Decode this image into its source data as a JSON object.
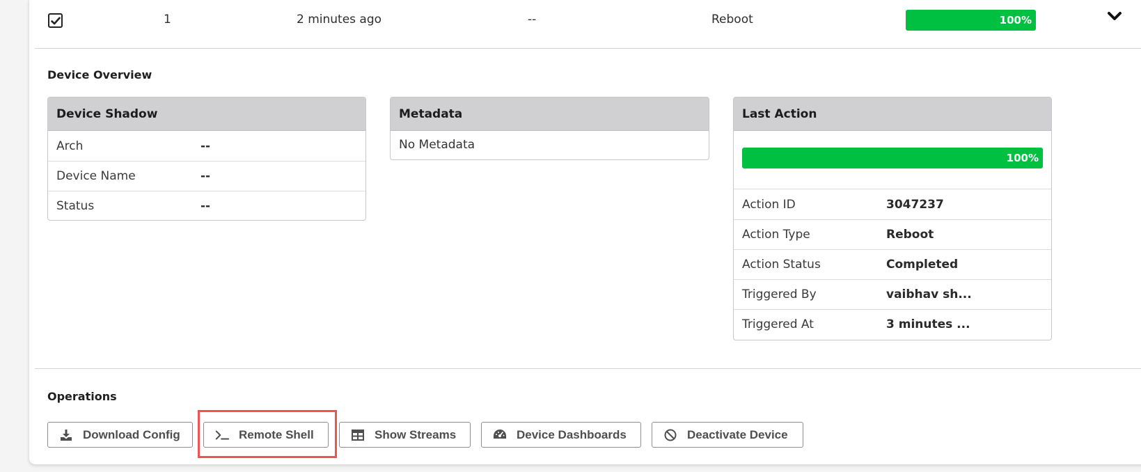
{
  "row": {
    "index": "1",
    "time": "2 minutes ago",
    "placeholder": "--",
    "action": "Reboot",
    "progress_label": "100%",
    "progress": 1.0,
    "checked": true
  },
  "overview": {
    "title": "Device Overview",
    "device_shadow": {
      "title": "Device Shadow",
      "rows": [
        {
          "key": "Arch",
          "value": "--"
        },
        {
          "key": "Device Name",
          "value": "--"
        },
        {
          "key": "Status",
          "value": "--"
        }
      ]
    },
    "metadata": {
      "title": "Metadata",
      "empty_text": "No Metadata"
    },
    "last_action": {
      "title": "Last Action",
      "progress_label": "100%",
      "progress": 1.0,
      "rows": [
        {
          "key": "Action ID",
          "value": "3047237"
        },
        {
          "key": "Action Type",
          "value": "Reboot"
        },
        {
          "key": "Action Status",
          "value": "Completed"
        },
        {
          "key": "Triggered By",
          "value": "vaibhav sh..."
        },
        {
          "key": "Triggered At",
          "value": "3 minutes ..."
        }
      ]
    }
  },
  "operations": {
    "title": "Operations",
    "buttons": [
      {
        "label": "Download Config",
        "icon": "download-icon"
      },
      {
        "label": "Remote Shell",
        "icon": "terminal-icon"
      },
      {
        "label": "Show Streams",
        "icon": "table-icon"
      },
      {
        "label": "Device Dashboards",
        "icon": "dashboard-gauge-icon"
      },
      {
        "label": "Deactivate Device",
        "icon": "ban-icon"
      }
    ]
  },
  "colors": {
    "progress": "#00c041",
    "highlight": "#ec5553",
    "table_header": "#d0d0d2"
  }
}
